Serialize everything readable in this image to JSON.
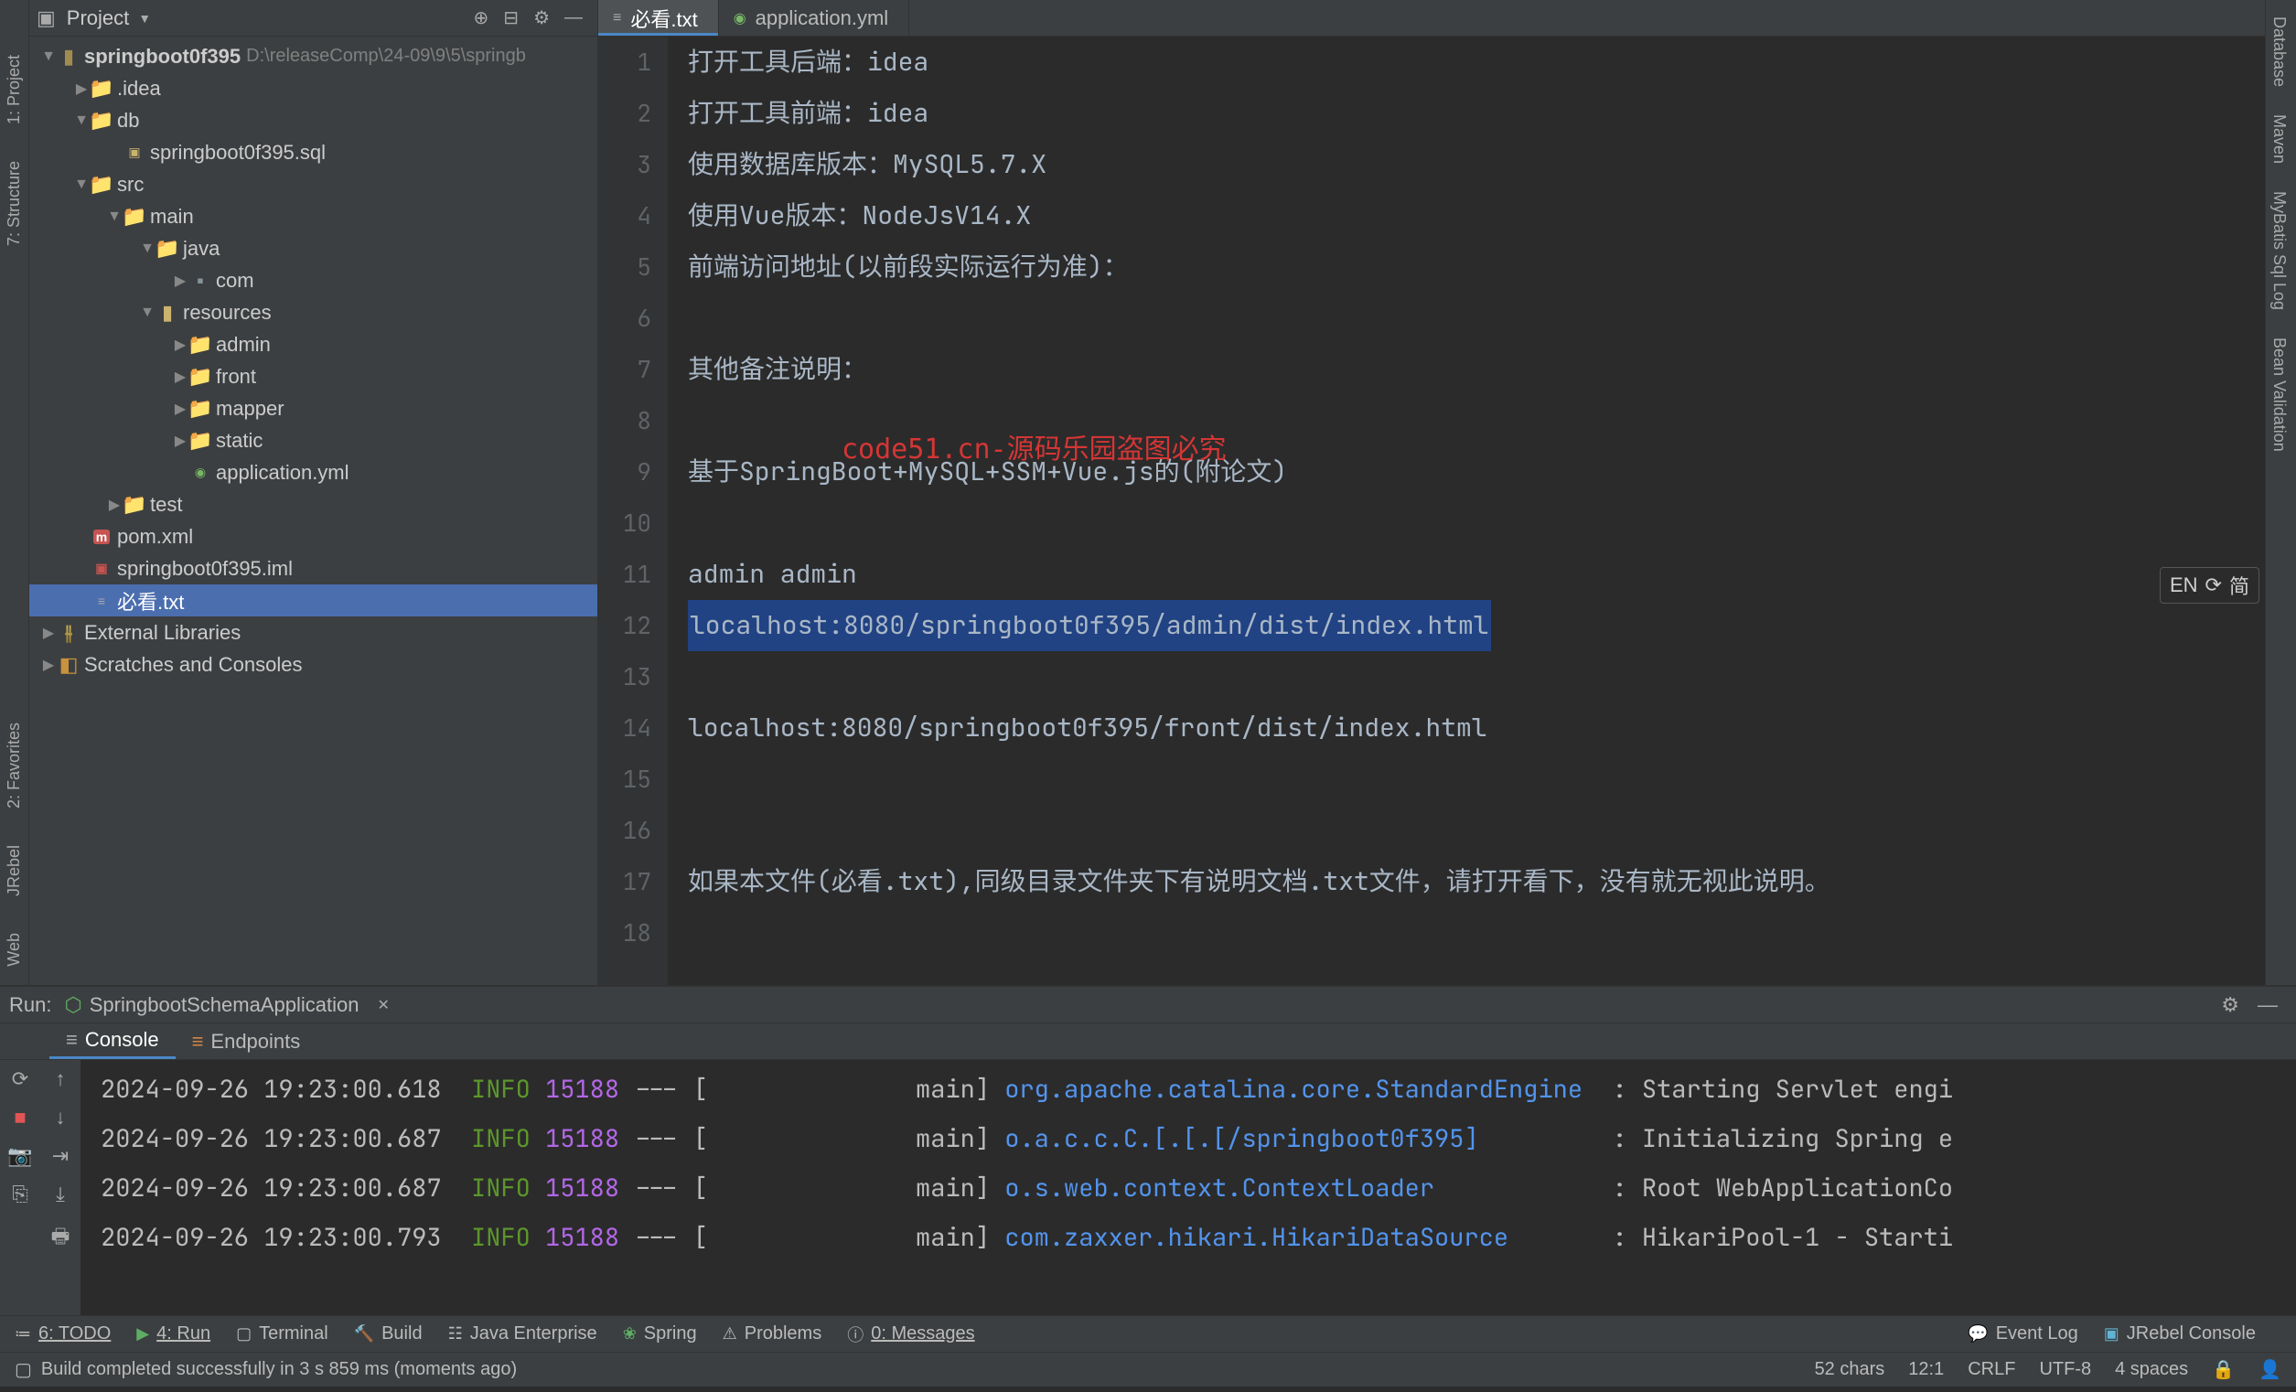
{
  "sidebar_left": {
    "project": "1: Project",
    "structure": "7: Structure",
    "favorites": "2: Favorites",
    "jrebel": "JRebel",
    "web": "Web"
  },
  "sidebar_right": {
    "database": "Database",
    "maven": "Maven",
    "mybatis": "MyBatis Sql Log",
    "beanvalid": "Bean Validation"
  },
  "project_panel": {
    "title": "Project",
    "toolbar": {
      "target": "⊕",
      "expand": "⊟",
      "gear": "⚙",
      "hide": "—"
    }
  },
  "tree": {
    "root_name": "springboot0f395",
    "root_path": "D:\\releaseComp\\24-09\\9\\5\\springb",
    "idea": ".idea",
    "db": "db",
    "sql_file": "springboot0f395.sql",
    "src": "src",
    "main": "main",
    "java": "java",
    "com": "com",
    "resources": "resources",
    "admin": "admin",
    "front": "front",
    "mapper": "mapper",
    "static": "static",
    "appyml": "application.yml",
    "test": "test",
    "pom": "pom.xml",
    "iml": "springboot0f395.iml",
    "bikan": "必看.txt",
    "extlib": "External Libraries",
    "scratches": "Scratches and Consoles"
  },
  "editor": {
    "tabs": [
      {
        "label": "必看.txt",
        "active": true,
        "icon": "txt"
      },
      {
        "label": "application.yml",
        "active": false,
        "icon": "yml"
      }
    ],
    "lines": [
      "打开工具后端：idea",
      "打开工具前端：idea",
      "使用数据库版本：MySQL5.7.X",
      "使用Vue版本：NodeJsV14.X",
      "前端访问地址(以前段实际运行为准)：",
      "",
      "其他备注说明：",
      "",
      "基于SpringBoot+MySQL+SSM+Vue.js的(附论文)",
      "",
      "admin admin",
      "localhost:8080/springboot0f395/admin/dist/index.html",
      "",
      "localhost:8080/springboot0f395/front/dist/index.html",
      "",
      "",
      "如果本文件(必看.txt),同级目录文件夹下有说明文档.txt文件，请打开看下，没有就无视此说明。",
      ""
    ],
    "highlight_line": 12,
    "red_watermark": "code51.cn-源码乐园盗图必究"
  },
  "right_float": {
    "lang": "EN",
    "sym": "⟳",
    "mode": "简"
  },
  "run": {
    "title": "Run:",
    "app": "SpringbootSchemaApplication",
    "console_tab": "Console",
    "endpoints_tab": "Endpoints",
    "logs": [
      {
        "ts": "2024-09-26 19:23:00.618",
        "level": "INFO",
        "pid": "15188",
        "thread": "main",
        "cls": "org.apache.catalina.core.StandardEngine",
        "msg": "Starting Servlet engi"
      },
      {
        "ts": "2024-09-26 19:23:00.687",
        "level": "INFO",
        "pid": "15188",
        "thread": "main",
        "cls": "o.a.c.c.C.[.[.[/springboot0f395]",
        "msg": "Initializing Spring e"
      },
      {
        "ts": "2024-09-26 19:23:00.687",
        "level": "INFO",
        "pid": "15188",
        "thread": "main",
        "cls": "o.s.web.context.ContextLoader",
        "msg": "Root WebApplicationCo"
      },
      {
        "ts": "2024-09-26 19:23:00.793",
        "level": "INFO",
        "pid": "15188",
        "thread": "main",
        "cls": "com.zaxxer.hikari.HikariDataSource",
        "msg": "HikariPool-1 - Starti"
      }
    ]
  },
  "bottom": {
    "todo": "6: TODO",
    "run": "4: Run",
    "terminal": "Terminal",
    "build": "Build",
    "javaee": "Java Enterprise",
    "spring": "Spring",
    "problems": "Problems",
    "messages": "0: Messages",
    "eventlog": "Event Log",
    "jrebel": "JRebel Console"
  },
  "status": {
    "build_msg": "Build completed successfully in 3 s 859 ms (moments ago)",
    "chars": "52 chars",
    "pos": "12:1",
    "lineend": "CRLF",
    "encoding": "UTF-8",
    "indent": "4 spaces"
  },
  "watermark_text": "code51.cn"
}
